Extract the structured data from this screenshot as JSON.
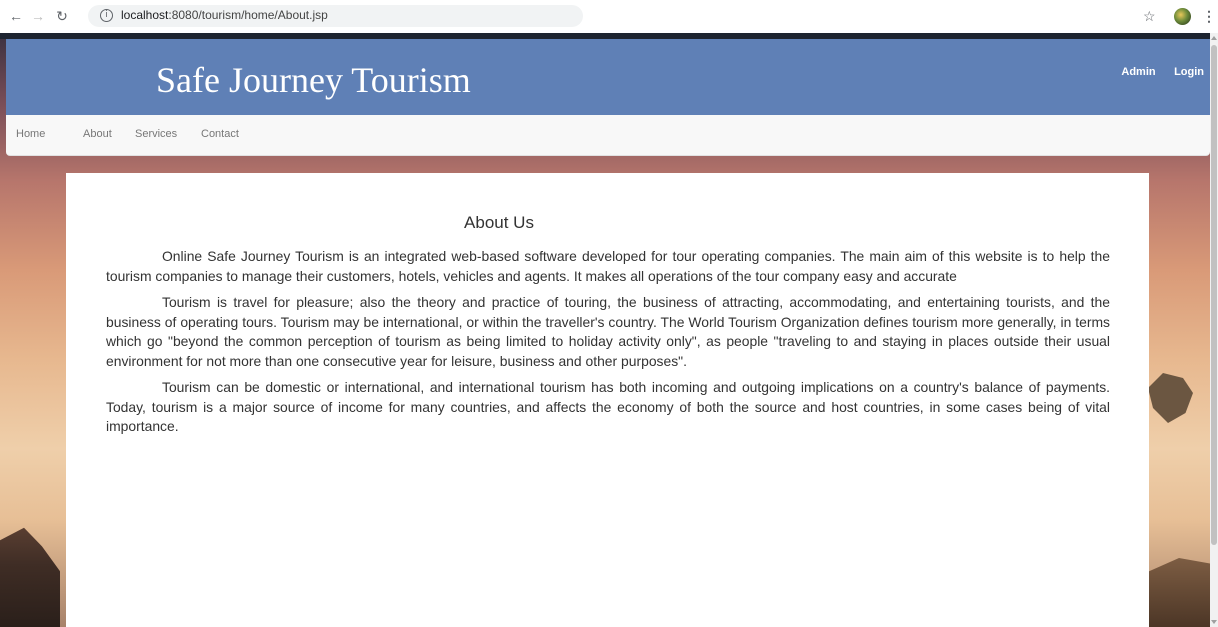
{
  "browser": {
    "url_host": "localhost",
    "url_rest": ":8080/tourism/home/About.jsp",
    "back_icon": "arrow-left-icon",
    "forward_icon": "arrow-right-icon",
    "reload_icon": "reload-icon",
    "info_glyph": "i",
    "star_icon": "star-icon",
    "menu_icon": "kebab-menu-icon"
  },
  "header": {
    "title": "Safe Journey Tourism",
    "admin_link": "Admin",
    "login_link": "Login",
    "color": "#5f80b6"
  },
  "nav": {
    "items": [
      {
        "label": "Home"
      },
      {
        "label": "About"
      },
      {
        "label": "Services"
      },
      {
        "label": "Contact"
      }
    ]
  },
  "content": {
    "title": "About Us",
    "paragraphs": [
      "Online Safe Journey Tourism is an integrated web-based software developed for tour operating companies. The main aim of this website is to help the tourism companies to manage their customers, hotels, vehicles and agents. It makes all operations of the tour company easy and accurate",
      "Tourism is travel for pleasure; also the theory and practice of touring, the business of attracting, accommodating, and entertaining tourists, and the business of operating tours. Tourism may be international, or within the traveller's country. The World Tourism Organization defines tourism more generally, in terms which go \"beyond the common perception of tourism as being limited to holiday activity only\", as people \"traveling to and staying in places outside their usual environment for not more than one consecutive year for leisure, business and other purposes\".",
      "Tourism can be domestic or international, and international tourism has both incoming and outgoing implications on a country's balance of payments. Today, tourism is a major source of income for many countries, and affects the economy of both the source and host countries, in some cases being of vital importance."
    ]
  }
}
